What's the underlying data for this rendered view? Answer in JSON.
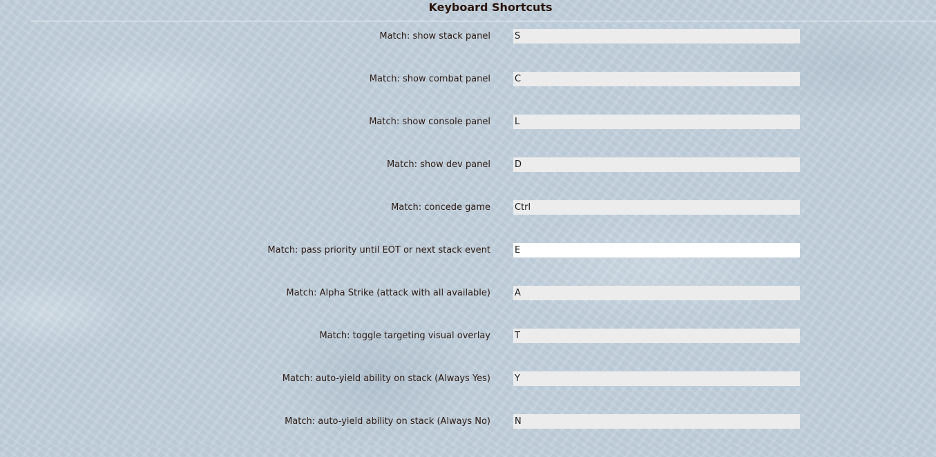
{
  "header": {
    "title": "Keyboard Shortcuts"
  },
  "shortcuts": [
    {
      "label": "Match: show stack panel",
      "value": "S"
    },
    {
      "label": "Match: show combat panel",
      "value": "C"
    },
    {
      "label": "Match: show console panel",
      "value": "L"
    },
    {
      "label": "Match: show dev panel",
      "value": "D"
    },
    {
      "label": "Match: concede game",
      "value": "Ctrl"
    },
    {
      "label": "Match: pass priority until EOT or next stack event",
      "value": "E"
    },
    {
      "label": "Match: Alpha Strike (attack with all available)",
      "value": "A"
    },
    {
      "label": "Match: toggle targeting visual overlay",
      "value": "T"
    },
    {
      "label": "Match: auto-yield ability on stack (Always Yes)",
      "value": "Y"
    },
    {
      "label": "Match: auto-yield ability on stack (Always No)",
      "value": "N"
    }
  ],
  "colors": {
    "background": "#c3d1dd",
    "text": "#2e1a12",
    "input_background": "#ececec",
    "input_focused_background": "#ffffff",
    "divider": "#f4f7fa"
  }
}
